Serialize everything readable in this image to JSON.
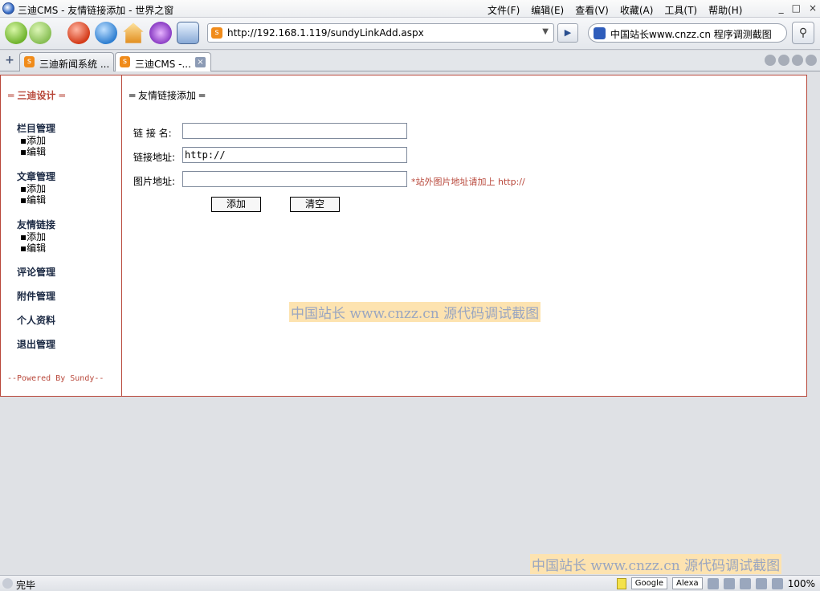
{
  "window": {
    "title": "三迪CMS - 友情链接添加 - 世界之窗",
    "menu": [
      "文件(F)",
      "编辑(E)",
      "查看(V)",
      "收藏(A)",
      "工具(T)",
      "帮助(H)"
    ],
    "controls": [
      "_",
      "□",
      "×"
    ]
  },
  "toolbar": {
    "address_url": "http://192.168.1.119/sundyLinkAdd.aspx",
    "search_text": "中国站长www.cnzz.cn 程序调测截图"
  },
  "tabs": [
    {
      "label": "三迪新闻系统 ..."
    },
    {
      "label": "三迪CMS -..."
    }
  ],
  "sidebar": {
    "title": "═ 三迪设计 ═",
    "groups": [
      {
        "title": "栏目管理",
        "items": [
          "▪添加",
          "▪编辑"
        ]
      },
      {
        "title": "文章管理",
        "items": [
          "▪添加",
          "▪编辑"
        ]
      },
      {
        "title": "友情链接",
        "items": [
          "▪添加",
          "▪编辑"
        ]
      },
      {
        "title": "评论管理",
        "items": []
      },
      {
        "title": "附件管理",
        "items": []
      },
      {
        "title": "个人资料",
        "items": []
      },
      {
        "title": "退出管理",
        "items": []
      }
    ],
    "powered": "--Powered By Sundy--"
  },
  "main": {
    "title": "═ 友情链接添加 ═",
    "fields": [
      {
        "label": "链 接 名:",
        "value": ""
      },
      {
        "label": "链接地址:",
        "value": "http://"
      },
      {
        "label": "图片地址:",
        "value": ""
      }
    ],
    "hint": "*站外图片地址请加上 http://",
    "add_button": "添加",
    "clear_button": "清空"
  },
  "watermark": "中国站长 www.cnzz.cn 源代码调试截图",
  "statusbar": {
    "text": "完毕",
    "google": "Google",
    "alexa": "Alexa",
    "zoom": "100%"
  }
}
